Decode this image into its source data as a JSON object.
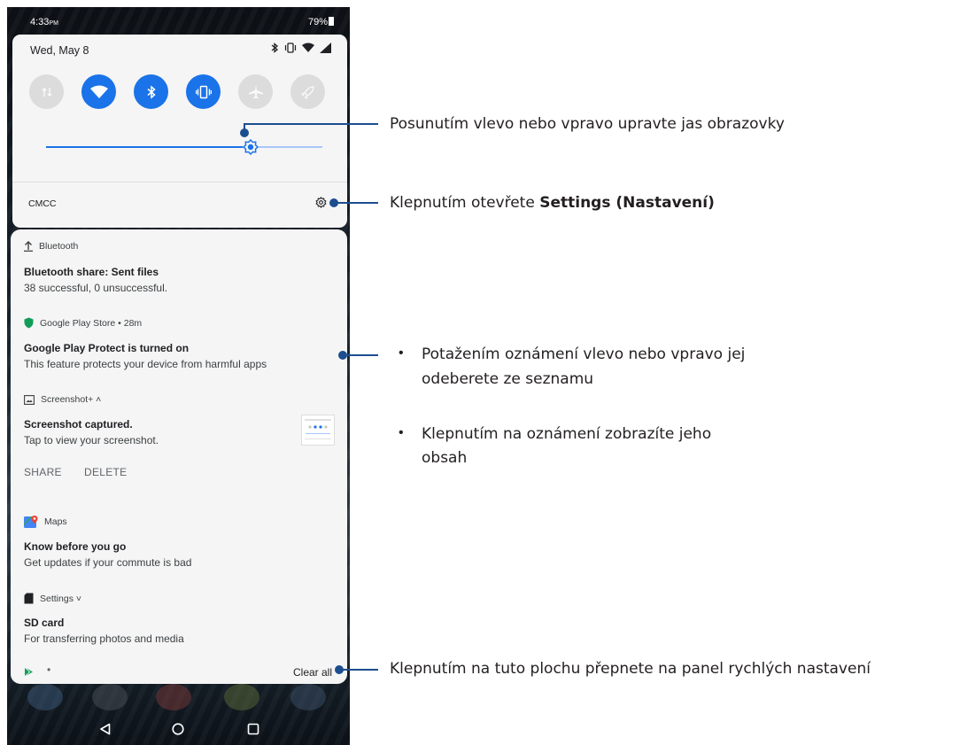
{
  "status_bar": {
    "time": "4:33",
    "ampm": "PM",
    "battery": "79%"
  },
  "quick_settings": {
    "date": "Wed, May 8",
    "tiles": [
      {
        "name": "mobile-data-icon",
        "state": "off"
      },
      {
        "name": "wifi-icon",
        "state": "on"
      },
      {
        "name": "bluetooth-icon",
        "state": "on"
      },
      {
        "name": "vibrate-icon",
        "state": "on"
      },
      {
        "name": "airplane-icon",
        "state": "off"
      },
      {
        "name": "rocket-icon",
        "state": "off"
      }
    ],
    "brightness_level": 0.74,
    "carrier": "CMCC"
  },
  "notifications": {
    "bluetooth": {
      "app": "Bluetooth",
      "title": "Bluetooth share: Sent files",
      "text": "38 successful, 0 unsuccessful."
    },
    "playstore": {
      "app": "Google Play Store • 28m",
      "title": "Google Play Protect is turned on",
      "text": "This feature protects your device from harmful apps"
    },
    "screenshot": {
      "app": "Screenshot+ ˄",
      "title": "Screenshot captured.",
      "text": "Tap to view your screenshot.",
      "share": "SHARE",
      "delete": "DELETE"
    },
    "maps": {
      "app": "Maps",
      "title": "Know before you go",
      "text": "Get updates if your commute is bad"
    },
    "settings": {
      "app": "Settings ˅",
      "title": "SD card",
      "text": "For transferring photos and media"
    },
    "footer": {
      "dot": "•",
      "clear_all": "Clear all"
    }
  },
  "colors": {
    "accent": "#1a73e8",
    "callout": "#1c4e8f"
  },
  "callouts": {
    "brightness": "Posunutím vlevo nebo vpravo upravte jas obrazovky",
    "settings_prefix": "Klepnutím otevřete ",
    "settings_bold": "Settings (Nastavení)",
    "swipe_line1": "Potažením oznámení vlevo nebo vpravo jej",
    "swipe_line2": "odeberete ze seznamu",
    "tap_line1": "Klepnutím na oznámení zobrazíte jeho",
    "tap_line2": "obsah",
    "bullet": "•",
    "quick_panel": "Klepnutím na tuto plochu přepnete na panel rychlých nastavení"
  }
}
